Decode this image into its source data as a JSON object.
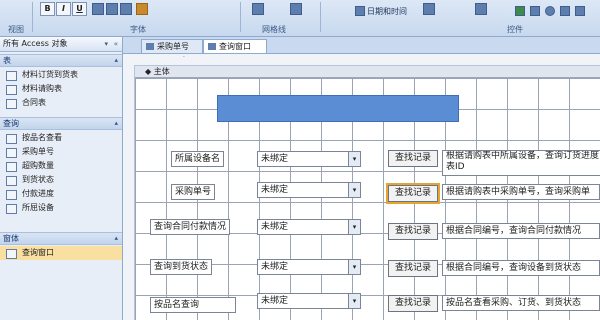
{
  "ribbon": {
    "groups": [
      "视图",
      "字体",
      "网格线",
      "控件"
    ],
    "buttons": {
      "bold": "B",
      "italic": "I",
      "underline": "U"
    },
    "datetime": "日期和时间"
  },
  "nav": {
    "header": "所有 Access 对象",
    "sections": [
      {
        "title": "表",
        "items": [
          "材料订货到货表",
          "材料请购表",
          "合同表"
        ]
      },
      {
        "title": "查询",
        "items": [
          "按品名查看",
          "采购单号",
          "超购数量",
          "到货状态",
          "付款进度",
          "所屈设备"
        ]
      },
      {
        "title": "窗体",
        "items": [
          "查询窗口"
        ]
      }
    ]
  },
  "tabs": [
    "采购单号",
    "查询窗口"
  ],
  "design": {
    "section": "主体",
    "rows": [
      {
        "label": "所属设备名",
        "combo": "未绑定",
        "button": "查找记录",
        "desc": "根据请购表中所属设备，查询订货进度表ID"
      },
      {
        "label": "采购单号",
        "combo": "未绑定",
        "button": "查找记录",
        "desc": "根据请购表中采购单号，查询采购单"
      },
      {
        "label": "查询合同付款情况",
        "combo": "未绑定",
        "button": "查找记录",
        "desc": "根据合同编号，查询合同付款情况"
      },
      {
        "label": "查询到货状态",
        "combo": "未绑定",
        "button": "查找记录",
        "desc": "根据合同编号，查询设备到货状态"
      },
      {
        "label": "按品名查询",
        "combo": "未绑定",
        "button": "查找记录",
        "desc": "按品名查看采购、订货、到货状态"
      }
    ]
  }
}
